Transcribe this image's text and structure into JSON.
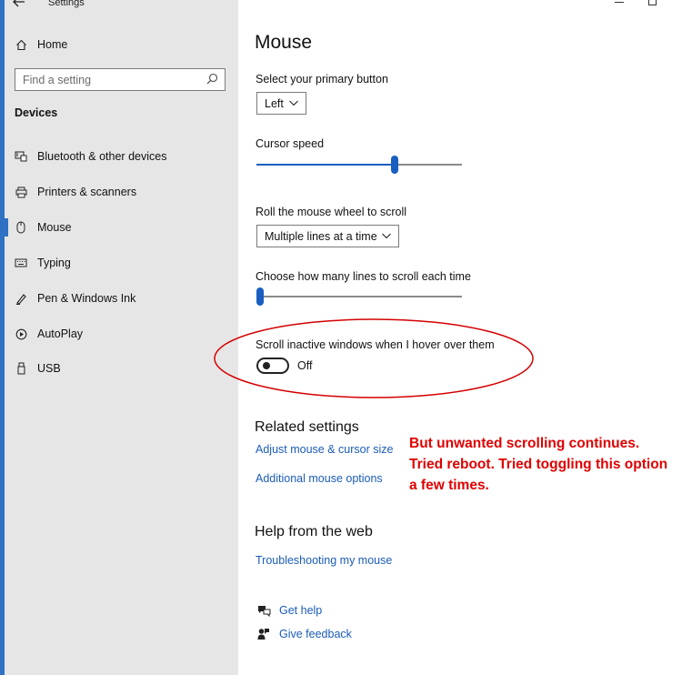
{
  "window": {
    "title": "Settings",
    "back_icon": "back-arrow-icon"
  },
  "sidebar": {
    "home_label": "Home",
    "search_placeholder": "Find a setting",
    "section_header": "Devices",
    "items": [
      {
        "label": "Bluetooth & other devices",
        "icon": "bluetooth-devices-icon"
      },
      {
        "label": "Printers & scanners",
        "icon": "printer-icon"
      },
      {
        "label": "Mouse",
        "icon": "mouse-icon",
        "selected": true
      },
      {
        "label": "Typing",
        "icon": "keyboard-icon"
      },
      {
        "label": "Pen & Windows Ink",
        "icon": "pen-icon"
      },
      {
        "label": "AutoPlay",
        "icon": "autoplay-icon"
      },
      {
        "label": "USB",
        "icon": "usb-icon"
      }
    ]
  },
  "main": {
    "title": "Mouse",
    "primary_button": {
      "label": "Select your primary button",
      "value": "Left"
    },
    "cursor_speed": {
      "label": "Cursor speed",
      "level_fraction": 0.68
    },
    "wheel_scroll": {
      "label": "Roll the mouse wheel to scroll",
      "value": "Multiple lines at a time"
    },
    "lines_to_scroll": {
      "label": "Choose how many lines to scroll each time",
      "level_fraction": 0.0
    },
    "inactive_scroll": {
      "label": "Scroll inactive windows when I hover over them",
      "state": "Off"
    },
    "related_settings": {
      "header": "Related settings",
      "links": [
        "Adjust mouse & cursor size",
        "Additional mouse options"
      ]
    },
    "help_from_web": {
      "header": "Help from the web",
      "link": "Troubleshooting my mouse"
    },
    "get_help": "Get help",
    "give_feedback": "Give feedback"
  },
  "annotation": {
    "lines": [
      "But unwanted scrolling continues.",
      "Tried reboot. Tried toggling this option",
      "a few times."
    ],
    "color": "#e00000"
  },
  "colors": {
    "accent": "#1a5fc0",
    "link": "#1b5cb8",
    "sidebar_bg": "#e6e6e6"
  }
}
